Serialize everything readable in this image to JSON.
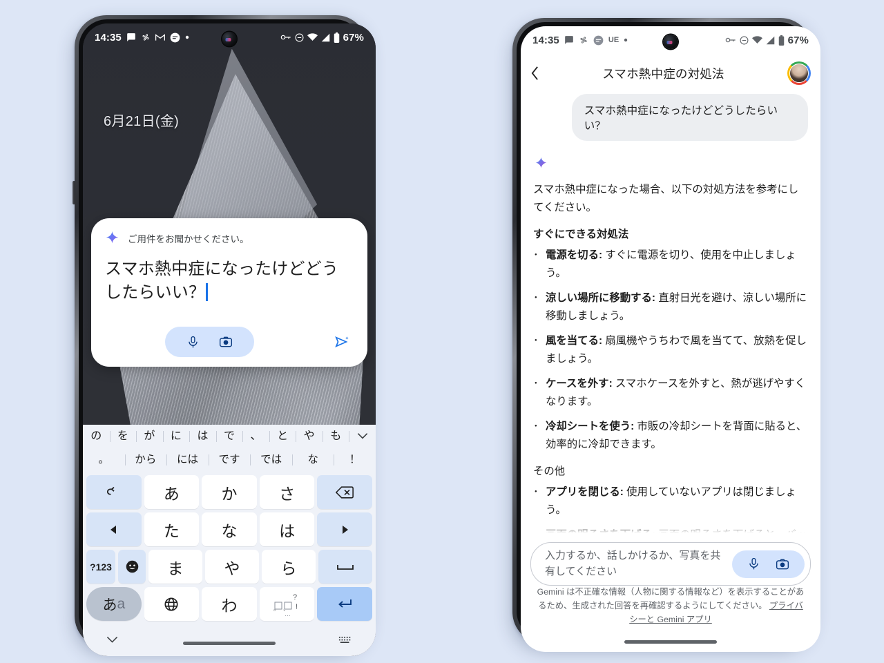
{
  "background_color": "#dde6f6",
  "left_phone": {
    "status_bar": {
      "clock": "14:35",
      "icons": [
        "chat-bubble-icon",
        "pinwheel-icon",
        "gmail-icon",
        "subtitles-icon",
        "dot-icon"
      ],
      "right_icons": [
        "vpn-key-icon",
        "do-not-disturb-icon",
        "wifi-icon",
        "signal-icon",
        "battery-icon"
      ],
      "battery": "67%"
    },
    "lockscreen": {
      "date": "6月21日(金)"
    },
    "assistant_card": {
      "sparkle_icon": "gemini-sparkle-icon",
      "hint": "ご用件をお聞かせください。",
      "input_value": "スマホ熱中症になったけどどうしたらいい？",
      "mic_icon": "microphone-icon",
      "camera_icon": "camera-icon",
      "send_icon": "send-icon"
    },
    "keyboard": {
      "suggestions_row1": [
        "の",
        "を",
        "が",
        "に",
        "は",
        "で",
        "、",
        "と",
        "や",
        "も"
      ],
      "expand_icon": "chevron-down-icon",
      "suggestions_row2": [
        "。",
        "から",
        "には",
        "です",
        "では",
        "な",
        "！"
      ],
      "rows": [
        [
          {
            "label": "↩",
            "name": "undo-key",
            "style": "fn"
          },
          {
            "label": "あ",
            "name": "key-a",
            "style": ""
          },
          {
            "label": "か",
            "name": "key-ka",
            "style": ""
          },
          {
            "label": "さ",
            "name": "key-sa",
            "style": ""
          },
          {
            "label": "⌫",
            "name": "backspace-key",
            "style": "fn"
          }
        ],
        [
          {
            "label": "◀",
            "name": "cursor-left-key",
            "style": "fn"
          },
          {
            "label": "た",
            "name": "key-ta",
            "style": ""
          },
          {
            "label": "な",
            "name": "key-na",
            "style": ""
          },
          {
            "label": "は",
            "name": "key-ha",
            "style": ""
          },
          {
            "label": "▶",
            "name": "cursor-right-key",
            "style": "fn"
          }
        ],
        [
          {
            "label": "?123",
            "name": "symbols-key",
            "style": "fn sm"
          },
          {
            "label": "☺",
            "name": "emoji-key",
            "style": "fn"
          },
          {
            "label": "ま",
            "name": "key-ma",
            "style": ""
          },
          {
            "label": "や",
            "name": "key-ya",
            "style": ""
          },
          {
            "label": "ら",
            "name": "key-ra",
            "style": ""
          },
          {
            "label": "␣",
            "name": "space-key",
            "style": "fn"
          }
        ],
        [
          {
            "label": "あa",
            "name": "input-mode-switch-key",
            "style": "modeswitch"
          },
          {
            "label": "🌐",
            "name": "globe-key",
            "style": ""
          },
          {
            "label": "わ",
            "name": "key-wa",
            "style": ""
          },
          {
            "label": "、。?!",
            "name": "punctuation-key",
            "style": ""
          },
          {
            "label": "↵",
            "name": "enter-key",
            "style": "enter"
          }
        ]
      ],
      "nav_left_icon": "chevron-down-icon",
      "nav_right_icon": "keyboard-switch-icon"
    }
  },
  "right_phone": {
    "status_bar": {
      "clock": "14:35",
      "icons": [
        "chat-bubble-icon",
        "pinwheel-icon",
        "subtitles-icon",
        "ue-label",
        "dot-icon"
      ],
      "ue_label": "UE",
      "right_icons": [
        "vpn-key-icon",
        "do-not-disturb-icon",
        "wifi-icon",
        "signal-icon",
        "battery-icon"
      ],
      "battery": "67%"
    },
    "header": {
      "back_icon": "back-chevron-icon",
      "title": "スマホ熱中症の対処法",
      "avatar": "user-avatar"
    },
    "chat": {
      "user_message": "スマホ熱中症になったけどどうしたらいい？",
      "assistant_icon": "gemini-sparkle-icon",
      "intro": "スマホ熱中症になった場合、以下の対処方法を参考にしてください。",
      "sections": [
        {
          "heading": "すぐにできる対処法",
          "heading_bold": true,
          "items": [
            {
              "term": "電源を切る:",
              "desc": " すぐに電源を切り、使用を中止しましょう。"
            },
            {
              "term": "涼しい場所に移動する:",
              "desc": " 直射日光を避け、涼しい場所に移動しましょう。"
            },
            {
              "term": "風を当てる:",
              "desc": " 扇風機やうちわで風を当てて、放熱を促しましょう。"
            },
            {
              "term": "ケースを外す:",
              "desc": " スマホケースを外すと、熱が逃げやすくなります。"
            },
            {
              "term": "冷却シートを使う:",
              "desc": " 市販の冷却シートを背面に貼ると、効率的に冷却できます。"
            }
          ]
        },
        {
          "heading": "その他",
          "heading_bold": false,
          "items": [
            {
              "term": "アプリを閉じる:",
              "desc": " 使用していないアプリは閉じましょう。"
            },
            {
              "term": "画面の明るさを下げる:",
              "desc": " 画面の明るさを下げると、バッテリーの消費を抑え、発熱を抑制できます。"
            }
          ]
        }
      ]
    },
    "composer": {
      "placeholder": "入力するか、話しかけるか、写真を共有してください",
      "mic_icon": "microphone-icon",
      "camera_icon": "camera-icon"
    },
    "disclaimer": {
      "text": "Gemini は不正確な情報（人物に関する情報など）を表示することがあるため、生成された回答を再確認するようにしてください。",
      "link": "プライバシーと Gemini アプリ"
    }
  }
}
